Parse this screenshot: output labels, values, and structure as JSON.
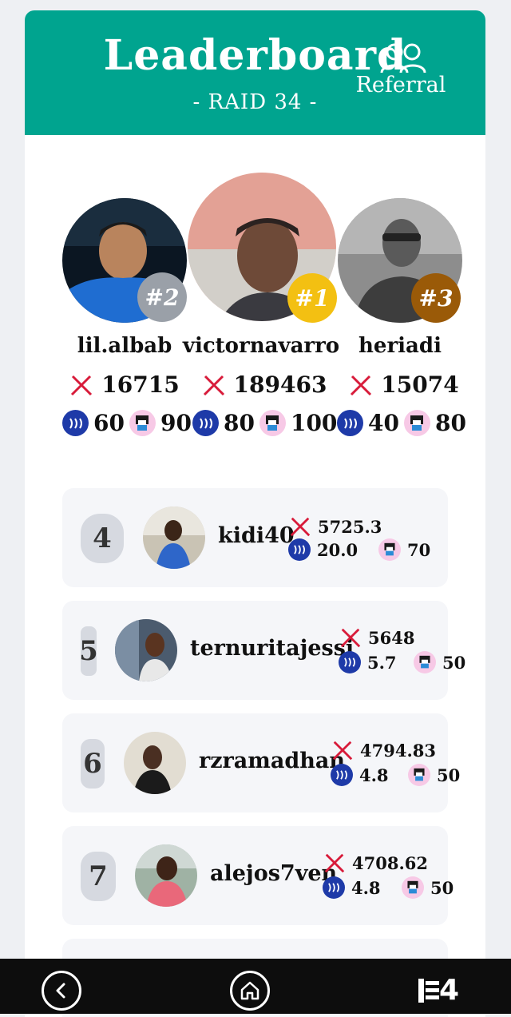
{
  "header": {
    "title": "Leaderboard",
    "subtitle": "- RAID 34 -",
    "referral_label": "Referral"
  },
  "podium": [
    {
      "rank_badge": "#2",
      "name": "lil.albab",
      "score": "16715",
      "steem": "60",
      "token": "90",
      "badge_color": "#9aa0a8"
    },
    {
      "rank_badge": "#1",
      "name": "victornavarro",
      "score": "189463",
      "steem": "80",
      "token": "100",
      "badge_color": "#f3c012"
    },
    {
      "rank_badge": "#3",
      "name": "heriadi",
      "score": "15074",
      "steem": "40",
      "token": "80",
      "badge_color": "#9a5a08"
    }
  ],
  "rows": [
    {
      "rank": "4",
      "name": "kidi40",
      "score": "5725.3",
      "steem": "20.0",
      "token": "70"
    },
    {
      "rank": "5",
      "name": "ternuritajessi",
      "score": "5648",
      "steem": "5.7",
      "token": "50"
    },
    {
      "rank": "6",
      "name": "rzramadhan",
      "score": "4794.83",
      "steem": "4.8",
      "token": "50"
    },
    {
      "rank": "7",
      "name": "alejos7ven",
      "score": "4708.62",
      "steem": "4.8",
      "token": "50"
    }
  ],
  "navbar": {
    "menu_label": "4"
  },
  "colors": {
    "header": "#00a48f",
    "steem": "#1e3aa8",
    "sword": "#d81b3a"
  },
  "icons": [
    "users-icon",
    "sword-icon",
    "steem-icon",
    "token-icon",
    "back-icon",
    "home-icon",
    "menu-icon"
  ]
}
